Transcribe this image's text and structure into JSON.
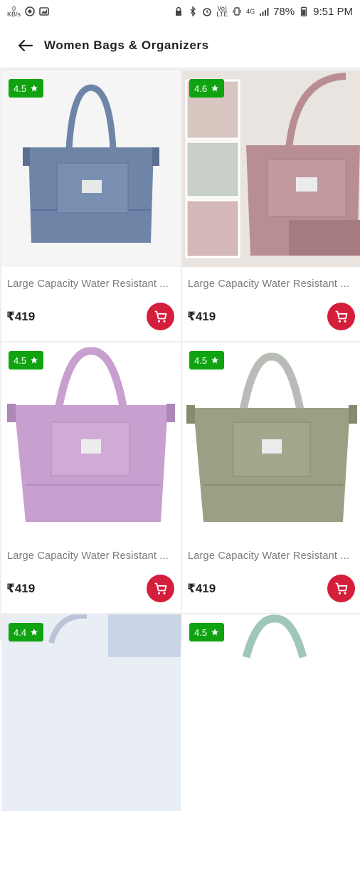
{
  "status_bar": {
    "net_speed_top": "0",
    "net_speed_bottom": "KB/s",
    "battery": "78%",
    "time": "9:51 PM",
    "sim_label_top": "Vo)",
    "sim_label_bottom": "LTE",
    "network": "4G"
  },
  "header": {
    "title": "Women Bags & Organizers"
  },
  "colors": {
    "rating_badge": "#10a311",
    "cart_button": "#d41e3c"
  },
  "products": [
    {
      "rating": "4.5",
      "name": "Large Capacity Water Resistant ...",
      "price": "₹419",
      "bag_color": "#6f85a8"
    },
    {
      "rating": "4.6",
      "name": "Large Capacity Water Resistant ...",
      "price": "₹419",
      "bag_color": "#b98e93"
    },
    {
      "rating": "4.5",
      "name": "Large Capacity Water Resistant ...",
      "price": "₹419",
      "bag_color": "#c7a0cf"
    },
    {
      "rating": "4.5",
      "name": "Large Capacity Water Resistant ...",
      "price": "₹419",
      "bag_color": "#9c9f84"
    },
    {
      "rating": "4.4"
    },
    {
      "rating": "4.5"
    }
  ]
}
